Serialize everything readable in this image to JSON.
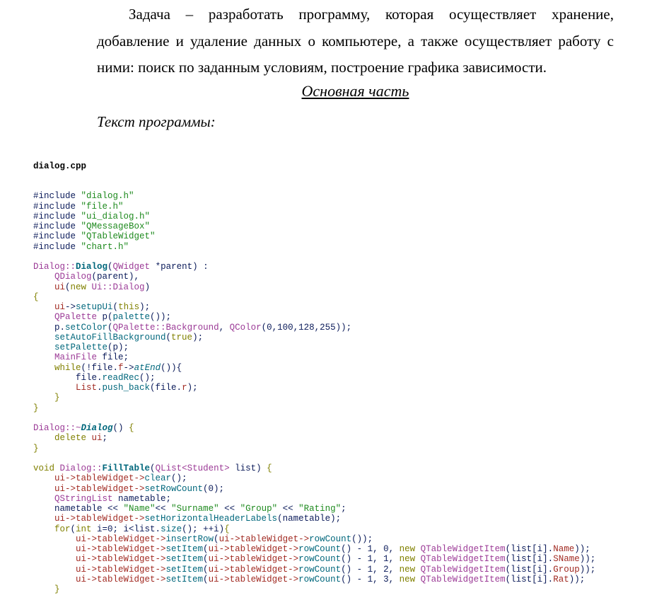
{
  "document": {
    "paragraph": "Задача – разработать программу, которая осуществляет хранение, добавление и удаление данных о компьютере, а также осуществляет работу с ними: поиск по заданным условиям, построение графика зависимости.",
    "section_heading": "Основная часть",
    "subheading": "Текст программы:",
    "code_filename": "dialog.cpp",
    "code_lines": [
      [
        [
          "pp",
          "#include "
        ],
        [
          "s",
          "\"dialog.h\""
        ]
      ],
      [
        [
          "pp",
          "#include "
        ],
        [
          "s",
          "\"file.h\""
        ]
      ],
      [
        [
          "pp",
          "#include "
        ],
        [
          "s",
          "\"ui_dialog.h\""
        ]
      ],
      [
        [
          "pp",
          "#include "
        ],
        [
          "s",
          "\"QMessageBox\""
        ]
      ],
      [
        [
          "pp",
          "#include "
        ],
        [
          "s",
          "\"QTableWidget\""
        ]
      ],
      [
        [
          "pp",
          "#include "
        ],
        [
          "s",
          "\"chart.h\""
        ]
      ],
      [],
      [
        [
          "t",
          "Dialog::"
        ],
        [
          "f",
          "Dialog"
        ],
        [
          "p",
          "("
        ],
        [
          "t",
          "QWidget"
        ],
        [
          "p",
          " *parent) :"
        ]
      ],
      [
        [
          "p",
          "    "
        ],
        [
          "t",
          "QDialog"
        ],
        [
          "p",
          "(parent),"
        ]
      ],
      [
        [
          "v",
          "    ui"
        ],
        [
          "p",
          "("
        ],
        [
          "k",
          "new "
        ],
        [
          "t",
          "Ui::Dialog"
        ],
        [
          "p",
          ")"
        ]
      ],
      [
        [
          "k",
          "{"
        ]
      ],
      [
        [
          "v",
          "    ui"
        ],
        [
          "p",
          "->"
        ],
        [
          "m",
          "setupUi"
        ],
        [
          "p",
          "("
        ],
        [
          "k",
          "this"
        ],
        [
          "p",
          ");"
        ]
      ],
      [
        [
          "t",
          "    QPalette"
        ],
        [
          "p",
          " p("
        ],
        [
          "m",
          "palette"
        ],
        [
          "p",
          "());"
        ]
      ],
      [
        [
          "p",
          "    p."
        ],
        [
          "m",
          "setColor"
        ],
        [
          "p",
          "("
        ],
        [
          "t",
          "QPalette::Background"
        ],
        [
          "p",
          ", "
        ],
        [
          "t",
          "QColor"
        ],
        [
          "p",
          "(0,100,128,255));"
        ]
      ],
      [
        [
          "m",
          "    setAutoFillBackground"
        ],
        [
          "p",
          "("
        ],
        [
          "k",
          "true"
        ],
        [
          "p",
          ");"
        ]
      ],
      [
        [
          "m",
          "    setPalette"
        ],
        [
          "p",
          "(p);"
        ]
      ],
      [
        [
          "t",
          "    MainFile"
        ],
        [
          "p",
          " file;"
        ]
      ],
      [
        [
          "k",
          "    while"
        ],
        [
          "p",
          "(!file."
        ],
        [
          "v",
          "f"
        ],
        [
          "p",
          "->"
        ],
        [
          "mi",
          "atEnd"
        ],
        [
          "p",
          "()){"
        ]
      ],
      [
        [
          "p",
          "        file."
        ],
        [
          "m",
          "readRec"
        ],
        [
          "p",
          "();"
        ]
      ],
      [
        [
          "v",
          "        List"
        ],
        [
          "p",
          "."
        ],
        [
          "m",
          "push_back"
        ],
        [
          "p",
          "(file."
        ],
        [
          "v",
          "r"
        ],
        [
          "p",
          ");"
        ]
      ],
      [
        [
          "k",
          "    }"
        ]
      ],
      [
        [
          "k",
          "}"
        ]
      ],
      [],
      [
        [
          "t",
          "Dialog::~"
        ],
        [
          "fi",
          "Dialog"
        ],
        [
          "p",
          "() "
        ],
        [
          "k",
          "{"
        ]
      ],
      [
        [
          "k",
          "    delete "
        ],
        [
          "v",
          "ui"
        ],
        [
          "p",
          ";"
        ]
      ],
      [
        [
          "k",
          "}"
        ]
      ],
      [],
      [
        [
          "k",
          "void "
        ],
        [
          "t",
          "Dialog::"
        ],
        [
          "f",
          "FillTable"
        ],
        [
          "p",
          "("
        ],
        [
          "t",
          "QList<Student>"
        ],
        [
          "p",
          " list) "
        ],
        [
          "k",
          "{"
        ]
      ],
      [
        [
          "v",
          "    ui->tableWidget->"
        ],
        [
          "m",
          "clear"
        ],
        [
          "p",
          "();"
        ]
      ],
      [
        [
          "v",
          "    ui->tableWidget->"
        ],
        [
          "m",
          "setRowCount"
        ],
        [
          "p",
          "(0);"
        ]
      ],
      [
        [
          "t",
          "    QStringList"
        ],
        [
          "p",
          " nametable;"
        ]
      ],
      [
        [
          "p",
          "    nametable << "
        ],
        [
          "s",
          "\"Name\""
        ],
        [
          "p",
          "<< "
        ],
        [
          "s",
          "\"Surname\""
        ],
        [
          "p",
          " << "
        ],
        [
          "s",
          "\"Group\""
        ],
        [
          "p",
          " << "
        ],
        [
          "s",
          "\"Rating\""
        ],
        [
          "p",
          ";"
        ]
      ],
      [
        [
          "v",
          "    ui->tableWidget->"
        ],
        [
          "m",
          "setHorizontalHeaderLabels"
        ],
        [
          "p",
          "(nametable);"
        ]
      ],
      [
        [
          "k",
          "    for"
        ],
        [
          "p",
          "("
        ],
        [
          "k",
          "int"
        ],
        [
          "p",
          " i=0; i<list."
        ],
        [
          "m",
          "size"
        ],
        [
          "p",
          "(); ++i)"
        ],
        [
          "k",
          "{"
        ]
      ],
      [
        [
          "v",
          "        ui->tableWidget->"
        ],
        [
          "m",
          "insertRow"
        ],
        [
          "p",
          "("
        ],
        [
          "v",
          "ui->tableWidget->"
        ],
        [
          "m",
          "rowCount"
        ],
        [
          "p",
          "());"
        ]
      ],
      [
        [
          "v",
          "        ui->tableWidget->"
        ],
        [
          "m",
          "setItem"
        ],
        [
          "p",
          "("
        ],
        [
          "v",
          "ui->tableWidget->"
        ],
        [
          "m",
          "rowCount"
        ],
        [
          "p",
          "() - 1, 0, "
        ],
        [
          "k",
          "new "
        ],
        [
          "t",
          "QTableWidgetItem"
        ],
        [
          "p",
          "(list[i]."
        ],
        [
          "v",
          "Name"
        ],
        [
          "p",
          "));"
        ]
      ],
      [
        [
          "v",
          "        ui->tableWidget->"
        ],
        [
          "m",
          "setItem"
        ],
        [
          "p",
          "("
        ],
        [
          "v",
          "ui->tableWidget->"
        ],
        [
          "m",
          "rowCount"
        ],
        [
          "p",
          "() - 1, 1, "
        ],
        [
          "k",
          "new "
        ],
        [
          "t",
          "QTableWidgetItem"
        ],
        [
          "p",
          "(list[i]."
        ],
        [
          "v",
          "SName"
        ],
        [
          "p",
          "));"
        ]
      ],
      [
        [
          "v",
          "        ui->tableWidget->"
        ],
        [
          "m",
          "setItem"
        ],
        [
          "p",
          "("
        ],
        [
          "v",
          "ui->tableWidget->"
        ],
        [
          "m",
          "rowCount"
        ],
        [
          "p",
          "() - 1, 2, "
        ],
        [
          "k",
          "new "
        ],
        [
          "t",
          "QTableWidgetItem"
        ],
        [
          "p",
          "(list[i]."
        ],
        [
          "v",
          "Group"
        ],
        [
          "p",
          "));"
        ]
      ],
      [
        [
          "v",
          "        ui->tableWidget->"
        ],
        [
          "m",
          "setItem"
        ],
        [
          "p",
          "("
        ],
        [
          "v",
          "ui->tableWidget->"
        ],
        [
          "m",
          "rowCount"
        ],
        [
          "p",
          "() - 1, 3, "
        ],
        [
          "k",
          "new "
        ],
        [
          "t",
          "QTableWidgetItem"
        ],
        [
          "p",
          "(list[i]."
        ],
        [
          "v",
          "Rat"
        ],
        [
          "p",
          "));"
        ]
      ],
      [
        [
          "k",
          "    }"
        ]
      ]
    ]
  }
}
